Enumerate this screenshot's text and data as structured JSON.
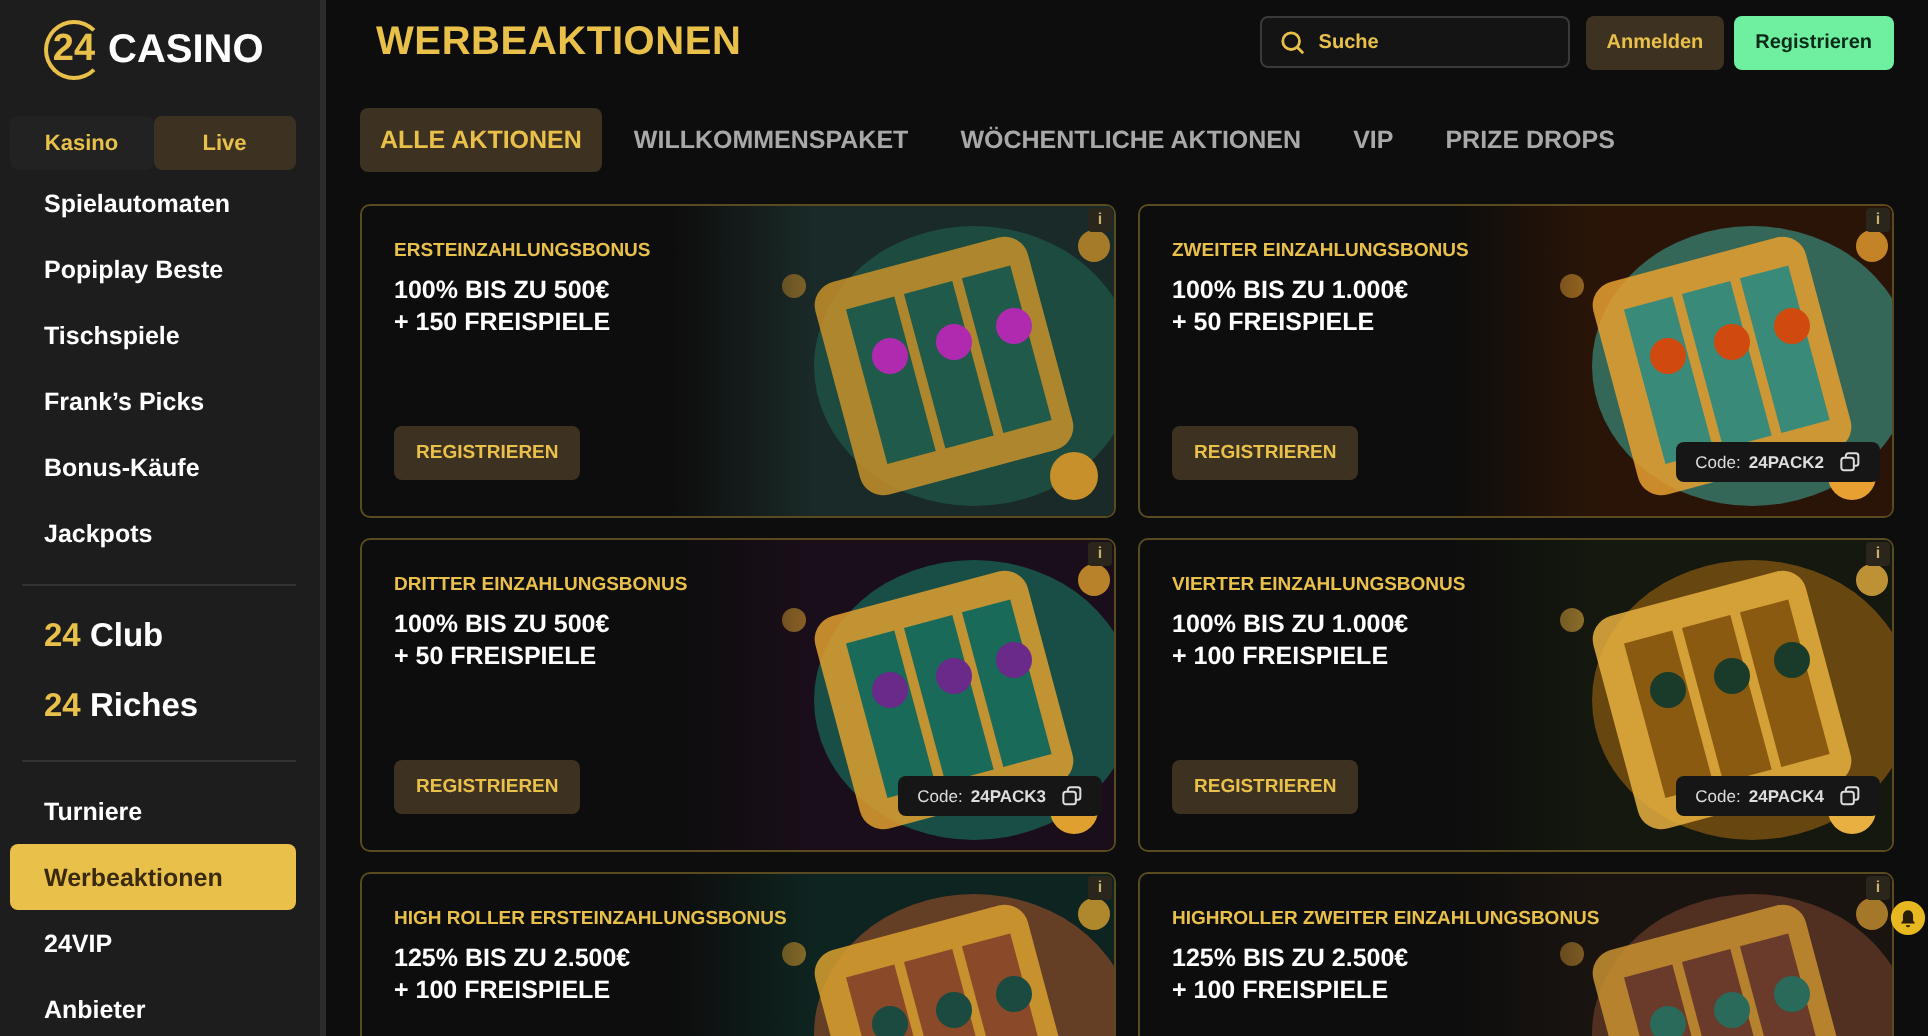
{
  "sidebar": {
    "logo": {
      "number": "24",
      "name": "CASINO"
    },
    "tabs": [
      {
        "label": "Kasino",
        "selected": false
      },
      {
        "label": "Live",
        "selected": true
      }
    ],
    "games": [
      {
        "label": "Spielautomaten",
        "selected": false
      },
      {
        "label": "Popiplay Beste",
        "selected": false
      },
      {
        "label": "Tischspiele",
        "selected": false
      },
      {
        "label": "Frank’s Picks",
        "selected": false
      },
      {
        "label": "Bonus-Käufe",
        "selected": false
      },
      {
        "label": "Jackpots",
        "selected": false
      }
    ],
    "clubs": [
      {
        "prefix": "24",
        "label": "Club"
      },
      {
        "prefix": "24",
        "label": "Riches"
      }
    ],
    "pages": [
      {
        "label": "Turniere",
        "selected": false
      },
      {
        "label": "Werbeaktionen",
        "selected": true
      },
      {
        "label": "24VIP",
        "selected": false
      },
      {
        "label": "Anbieter",
        "selected": false
      }
    ]
  },
  "header": {
    "title": "WERBEAKTIONEN",
    "search": {
      "placeholder": "Suche"
    },
    "login": "Anmelden",
    "register": "Registrieren"
  },
  "filters": [
    {
      "label": "ALLE AKTIONEN",
      "selected": true
    },
    {
      "label": "WILLKOMMENSPAKET",
      "selected": false
    },
    {
      "label": "WÖCHENTLICHE AKTIONEN",
      "selected": false
    },
    {
      "label": "VIP",
      "selected": false
    },
    {
      "label": "PRIZE DROPS",
      "selected": false
    }
  ],
  "promos": [
    {
      "info": "i",
      "title": "ERSTEINZAHLUNGSBONUS",
      "lines": [
        "100% BIS ZU 500€",
        "+ 150 FREISPIELE"
      ],
      "button": "REGISTRIEREN"
    },
    {
      "info": "i",
      "title": "ZWEITER EINZAHLUNGSBONUS",
      "lines": [
        "100% BIS ZU 1.000€",
        "+ 50 FREISPIELE"
      ],
      "button": "REGISTRIEREN",
      "code_label": "Code:",
      "code": "24PACK2"
    },
    {
      "info": "i",
      "title": "DRITTER EINZAHLUNGSBONUS",
      "lines": [
        "100% BIS ZU 500€",
        "+ 50 FREISPIELE"
      ],
      "button": "REGISTRIEREN",
      "code_label": "Code:",
      "code": "24PACK3"
    },
    {
      "info": "i",
      "title": "VIERTER EINZAHLUNGSBONUS",
      "lines": [
        "100% BIS ZU 1.000€",
        "+ 100 FREISPIELE"
      ],
      "button": "REGISTRIEREN",
      "code_label": "Code:",
      "code": "24PACK4"
    },
    {
      "info": "i",
      "title": "HIGH ROLLER ERSTEINZAHLUNGSBONUS",
      "lines": [
        "125% BIS ZU 2.500€",
        "+ 100 FREISPIELE"
      ]
    },
    {
      "info": "i",
      "title": "HIGHROLLER ZWEITER EINZAHLUNGSBONUS",
      "lines": [
        "125% BIS ZU 2.500€",
        "+ 100 FREISPIELE"
      ]
    }
  ]
}
